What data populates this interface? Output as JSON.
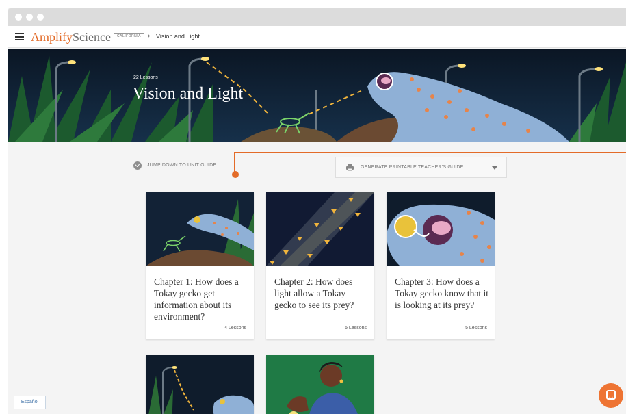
{
  "app": {
    "brand_primary": "Amplify",
    "brand_secondary": "Science",
    "state_badge": "CALIFORNIA",
    "breadcrumb_separator": "›",
    "breadcrumb_current": "Vision and Light"
  },
  "hero": {
    "lesson_count": "22 Lessons",
    "title": "Vision and Light"
  },
  "actions": {
    "jump_label": "JUMP DOWN TO UNIT GUIDE",
    "generate_label": "GENERATE PRINTABLE TEACHER'S GUIDE"
  },
  "chapters": [
    {
      "title": "Chapter 1: How does a Tokay gecko get information about its environment?",
      "lessons": "4 Lessons"
    },
    {
      "title": "Chapter 2: How does light allow a Tokay gecko to see its prey?",
      "lessons": "5 Lessons"
    },
    {
      "title": "Chapter 3: How does a Tokay gecko know that it is looking at its prey?",
      "lessons": "5 Lessons"
    },
    {
      "title": "",
      "lessons": ""
    },
    {
      "title": "",
      "lessons": ""
    }
  ],
  "footer": {
    "language_button": "Español"
  },
  "icons": {
    "menu": "hamburger-icon",
    "jump": "chevron-down-circle-icon",
    "print": "printer-icon",
    "dropdown": "caret-down-icon",
    "chat": "chat-icon"
  },
  "colors": {
    "accent": "#e36b28",
    "chat": "#ee7433",
    "night": "#0d1b2a",
    "grass": "#1f5a2a",
    "gecko": "#8fb0d6",
    "page_bg": "#f4f4f4"
  }
}
